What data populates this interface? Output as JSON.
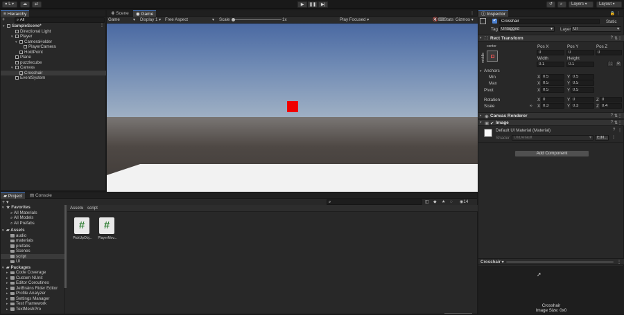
{
  "toolbar": {
    "account": "L",
    "tools": [
      "cloud-icon",
      "collab-icon"
    ],
    "history_icon": "history-icon",
    "search_icon": "search-icon",
    "layers": "Layers",
    "layout": "Layout"
  },
  "hierarchy": {
    "tab": "Hierarchy",
    "add": "+",
    "search_placeholder": "All",
    "items": [
      {
        "label": "SampleScene*",
        "type": "scene"
      },
      {
        "label": "Directional Light",
        "type": "obj"
      },
      {
        "label": "Player",
        "type": "obj"
      },
      {
        "label": "CameraHolder",
        "type": "obj"
      },
      {
        "label": "PlayerCamera",
        "type": "obj"
      },
      {
        "label": "HoldPoint",
        "type": "obj"
      },
      {
        "label": "Plane",
        "type": "obj"
      },
      {
        "label": "puzzlecube",
        "type": "obj"
      },
      {
        "label": "Canvas",
        "type": "obj"
      },
      {
        "label": "Crosshair",
        "type": "obj",
        "selected": true
      },
      {
        "label": "EventSystem",
        "type": "obj"
      }
    ]
  },
  "scene_tabs": [
    "Scene",
    "Game"
  ],
  "game_bar": {
    "mode": "Game",
    "display": "Display 1",
    "aspect": "Free Aspect",
    "scale_label": "Scale",
    "scale_value": "1x",
    "play_focused": "Play Focused",
    "stats": "Stats",
    "gizmos": "Gizmos"
  },
  "game_view": {
    "sky_top": "#4a69a2",
    "horizon": "#9fb0c4",
    "ground": "#4e4844",
    "floor": "#f2f2f2",
    "crosshair_color": "#ef0000"
  },
  "project": {
    "tabs": [
      "Project",
      "Console"
    ],
    "add": "+",
    "breadcrumb": [
      "Assets",
      "script"
    ],
    "count": "14",
    "favorites": {
      "label": "Favorites",
      "items": [
        "All Materials",
        "All Models",
        "All Prefabs"
      ]
    },
    "assets": {
      "label": "Assets",
      "items": [
        "audio",
        "materials",
        "prefabs",
        "Scenes",
        "script",
        "UI"
      ]
    },
    "packages": {
      "label": "Packages",
      "items": [
        "Code Coverage",
        "Custom NUnit",
        "Editor Coroutines",
        "JetBrains Rider Editor",
        "Profile Analyzer",
        "Settings Manager",
        "Test Framework",
        "TextMeshPro"
      ]
    },
    "files": [
      {
        "name": "PickUpObj...",
        "icon": "#"
      },
      {
        "name": "PlayerMov...",
        "icon": "#"
      }
    ]
  },
  "inspector": {
    "tab": "Inspector",
    "name": "Crosshair",
    "static": "Static",
    "tag_label": "Tag",
    "tag": "Untagged",
    "layer_label": "Layer",
    "layer": "UI",
    "rect": {
      "title": "Rect Transform",
      "anchor_preset": "center",
      "side": "middle",
      "pos_x_label": "Pos X",
      "pos_y_label": "Pos Y",
      "pos_z_label": "Pos Z",
      "pos_x": "0",
      "pos_y": "0",
      "pos_z": "0",
      "width_label": "Width",
      "height_label": "Height",
      "width": "0.1",
      "height": "0.1",
      "r_label": "R",
      "anchors_label": "Anchors",
      "min_label": "Min",
      "max_label": "Max",
      "pivot_label": "Pivot",
      "min_x": "0.5",
      "min_y": "0.5",
      "max_x": "0.5",
      "max_y": "0.5",
      "pivot_x": "0.5",
      "pivot_y": "0.5",
      "rotation_label": "Rotation",
      "rot_x": "0",
      "rot_y": "0",
      "rot_z": "0",
      "scale_label": "Scale",
      "scale_x": "0.3",
      "scale_y": "0.3",
      "scale_z": "0.4"
    },
    "canvas_renderer": "Canvas Renderer",
    "image": {
      "title": "Image",
      "material": "Default UI Material (Material)",
      "shader_label": "Shader",
      "shader": "UI/Default",
      "edit": "Edit..."
    },
    "add_component": "Add Component",
    "preview": {
      "name": "Crosshair",
      "caption": "Crosshair",
      "size": "Image Size: 0x0"
    }
  }
}
